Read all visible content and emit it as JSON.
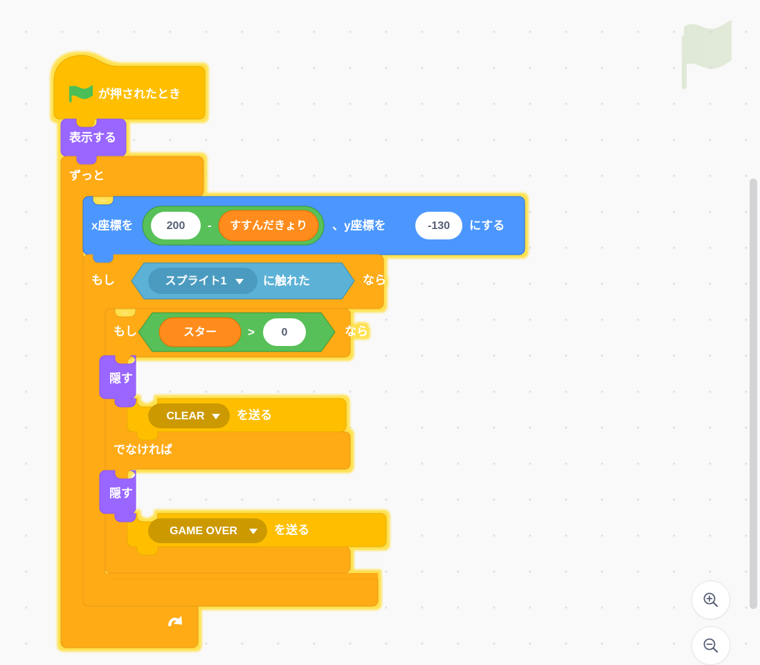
{
  "app": {
    "name": "Scratch",
    "area": "block-workspace",
    "language": "ja"
  },
  "workspace": {
    "background_color": "#f9f9f9",
    "grid_dot_color": "#e0e0e3",
    "watermark_icon": "green-flag-icon",
    "watermark_color": "#c3d6b0"
  },
  "colors": {
    "events": "#ffbf00",
    "events_dark": "#e6ac00",
    "control": "#ffab19",
    "control_dark": "#e69b12",
    "motion": "#4c97ff",
    "looks": "#9966ff",
    "sensing": "#5cb1d6",
    "sensing_dark": "#4b9bc0",
    "operators": "#59c059",
    "variables": "#ff8c1a",
    "glow": "#ffe14d",
    "input_white": "#ffffff",
    "input_text": "#575e75",
    "dropdown_shade": "#cc9900"
  },
  "script": {
    "selected": true,
    "glow_color": "#ffe14d",
    "blocks": [
      {
        "id": "when-flag-clicked",
        "type": "hat",
        "category": "events",
        "icon": "green-flag-icon",
        "label": "が押されたとき"
      },
      {
        "id": "show",
        "type": "stack",
        "category": "looks",
        "label": "表示する"
      },
      {
        "id": "forever",
        "type": "c-block",
        "category": "control",
        "label": "ずっと",
        "loop_icon": "loop-arrow-icon"
      },
      {
        "id": "go-to-xy",
        "type": "stack",
        "category": "motion",
        "label_1": "x座標を",
        "label_2": "、y座標を",
        "label_3": "にする",
        "operator": {
          "category": "operators",
          "symbol": "-",
          "left_value": "200",
          "right_variable": "すすんだきょり"
        },
        "y_value": "-130"
      },
      {
        "id": "if-touching",
        "type": "c-block",
        "category": "control",
        "label_if": "もし",
        "label_then": "なら",
        "condition": {
          "category": "sensing",
          "dropdown_value": "スプライト1",
          "label": "に触れた"
        }
      },
      {
        "id": "if-else-star",
        "type": "c-block-else",
        "category": "control",
        "label_if": "もし",
        "label_then": "なら",
        "label_else": "でなければ",
        "condition": {
          "category": "operators",
          "left_variable": "スター",
          "symbol": ">",
          "right_value": "0"
        }
      },
      {
        "id": "hide-1",
        "type": "stack",
        "category": "looks",
        "label": "隠す"
      },
      {
        "id": "broadcast-clear",
        "type": "stack",
        "category": "events",
        "dropdown_value": "CLEAR",
        "label": "を送る"
      },
      {
        "id": "hide-2",
        "type": "stack",
        "category": "looks",
        "label": "隠す"
      },
      {
        "id": "broadcast-game-over",
        "type": "stack",
        "category": "events",
        "dropdown_value": "GAME OVER",
        "label": "を送る"
      }
    ]
  },
  "controls": {
    "zoom_in": {
      "icon": "zoom-in-icon",
      "label": "Zoom in"
    },
    "zoom_out": {
      "icon": "zoom-out-icon",
      "label": "Zoom out"
    }
  },
  "scrollbar": {
    "orientation": "vertical",
    "thumb_color": "#d4d4d6"
  }
}
